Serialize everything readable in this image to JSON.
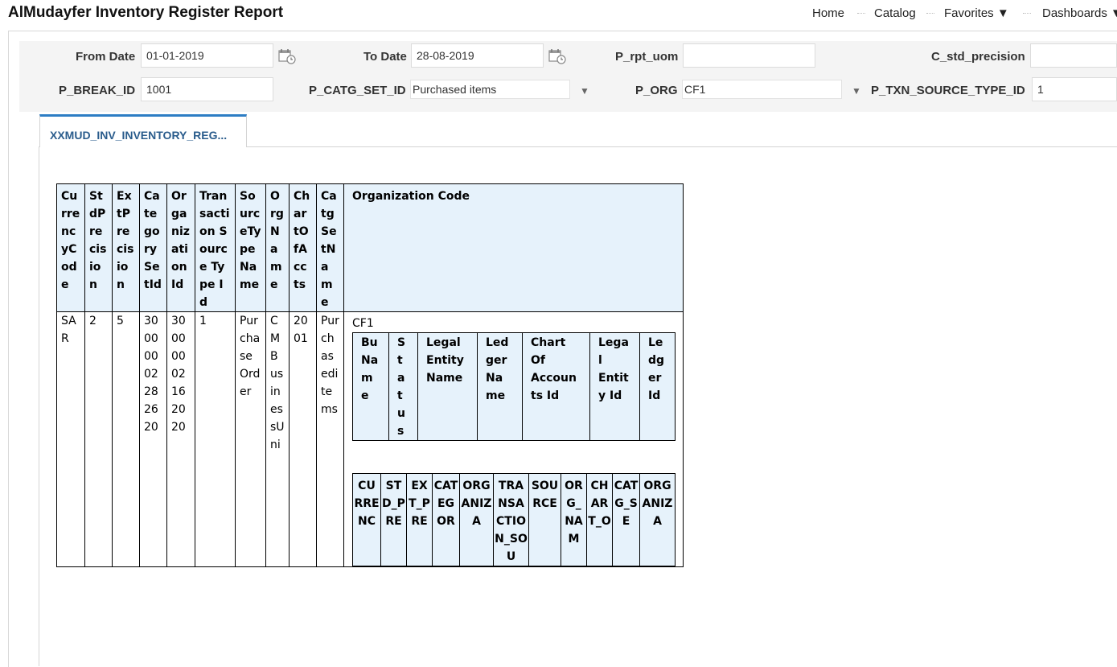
{
  "header": {
    "title": "AlMudayfer Inventory Register Report",
    "nav": [
      {
        "label": "Home"
      },
      {
        "label": "Catalog"
      },
      {
        "label": "Favorites ▼"
      },
      {
        "label": "Dashboards ▼"
      }
    ]
  },
  "prompts": {
    "from_date": {
      "label": "From Date",
      "value": "01-01-2019"
    },
    "to_date": {
      "label": "To Date",
      "value": "28-08-2019"
    },
    "p_rpt_uom": {
      "label": "P_rpt_uom",
      "value": ""
    },
    "c_std_precision": {
      "label": "C_std_precision",
      "value": ""
    },
    "p_break_id": {
      "label": "P_BREAK_ID",
      "value": "1001"
    },
    "p_catg_set_id": {
      "label": "P_CATG_SET_ID",
      "value": "Purchased items"
    },
    "p_org": {
      "label": "P_ORG",
      "value": "CF1"
    },
    "p_txn_source_type_id": {
      "label": "P_TXN_SOURCE_TYPE_ID",
      "value": "1"
    }
  },
  "tab": {
    "label": "XXMUD_INV_INVENTORY_REG..."
  },
  "report": {
    "headers": [
      "CurrencyCode",
      "StdPrecision",
      "ExtPrecision",
      "CategorySetId",
      "OrganizationId",
      "Transaction Source Type Id",
      "SourceTypeName",
      "OrgName",
      "ChartOfAccts",
      "CatgSetName",
      "Organization Code"
    ],
    "row": [
      "SAR",
      "2",
      "5",
      "30000002282620",
      "30000002162020",
      "1",
      "Purchase Order",
      "CMBusinessUni",
      "2001",
      "Purchaseditems",
      "CF1"
    ],
    "org_headers": [
      "Bu Name",
      "Status",
      "Legal Entity Name",
      "Ledger Name",
      "Chart Of Accounts Id",
      "Legal Entity Id",
      "Ledger Id"
    ],
    "detail_headers": [
      "CURRENC",
      "STD_PRE",
      "EXT_PRE",
      "CATEGOR",
      "ORGANIZA",
      "TRANSACTION_SOU",
      "SOURCE",
      "ORG_NAM",
      "CHART_O",
      "CATG_SE",
      "ORGANIZA"
    ]
  }
}
